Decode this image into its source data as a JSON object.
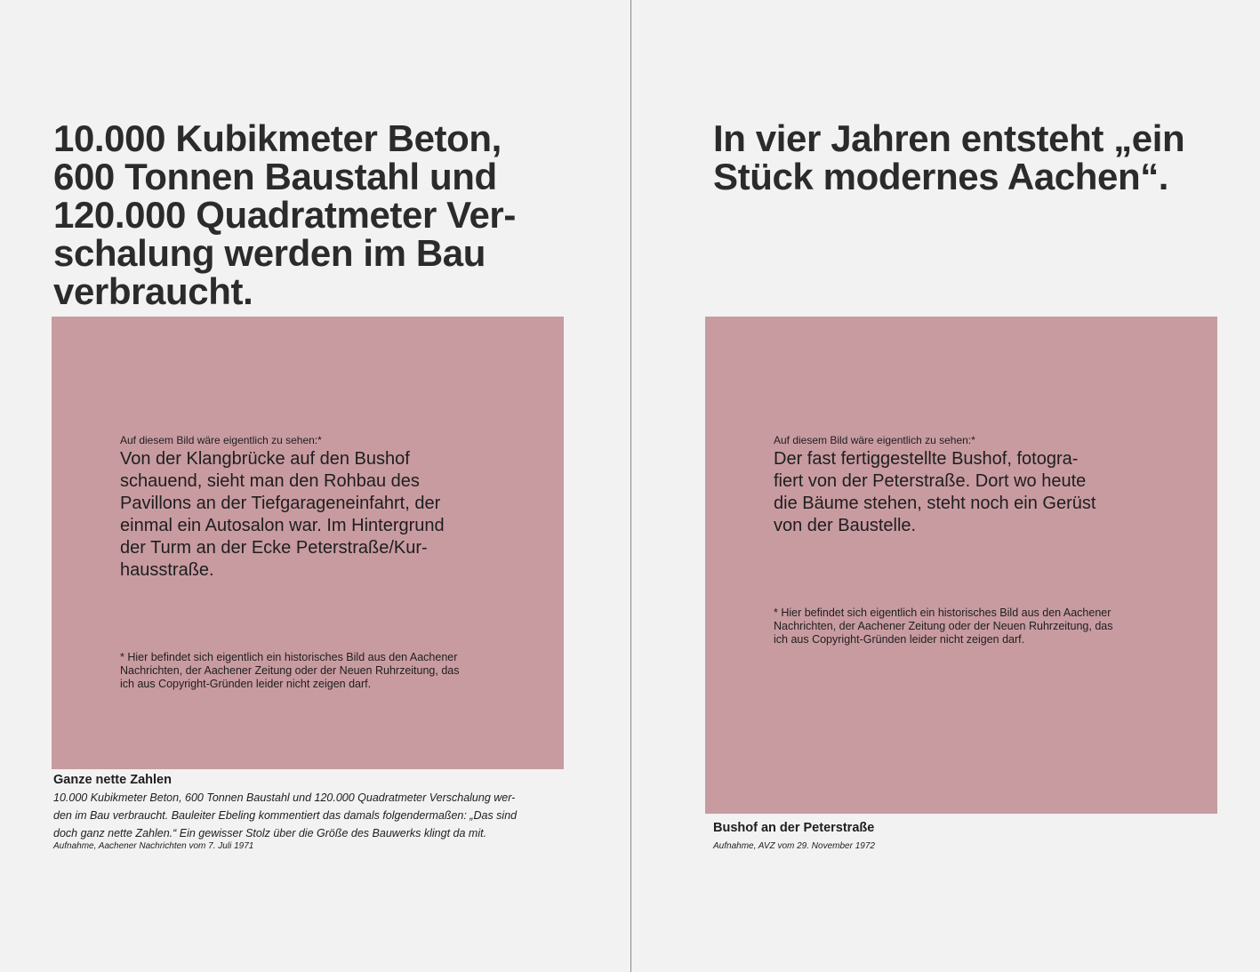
{
  "left_page": {
    "headline": "10.000 Kubikmeter Beton,\n600 Tonnen Baustahl und\n120.000 Quadratmeter Ver-\nschalung werden im Bau\nverbraucht.",
    "placeholder": {
      "intro": "Auf diesem Bild wäre eigentlich zu sehen:*",
      "description": "Von der Klangbrücke auf den Bushof\nschauend, sieht man den Rohbau des\nPavillons an der Tiefgarageneinfahrt, der\neinmal ein Autosalon war. Im Hintergrund\nder Turm an der Ecke Peterstraße/Kur-\nhausstraße.",
      "footnote": "* Hier befindet sich eigentlich ein historisches Bild aus den Aachener\nNachrichten, der Aachener Zeitung oder der Neuen Ruhrzeitung, das\nich aus Copyright-Gründen leider nicht zeigen darf."
    },
    "caption": {
      "title": "Ganze nette Zahlen",
      "text": "10.000 Kubikmeter Beton, 600 Tonnen Baustahl und 120.000 Quadratmeter Verschalung wer-\nden im Bau verbraucht. Bauleiter Ebeling kommentiert das damals folgendermaßen: „Das sind\ndoch ganz nette Zahlen.“ Ein gewisser Stolz über die Größe des Bauwerks klingt da mit.",
      "source": "Aufnahme, Aachener Nachrichten vom 7. Juli 1971"
    }
  },
  "right_page": {
    "headline": "In vier Jahren entsteht „ein\nStück modernes Aachen“.",
    "placeholder": {
      "intro": "Auf diesem Bild wäre eigentlich zu sehen:*",
      "description": "Der fast fertiggestellte Bushof, fotogra-\nfiert von der Peterstraße. Dort wo heute\ndie Bäume stehen, steht noch ein Gerüst\nvon der Baustelle.",
      "footnote": "* Hier befindet sich eigentlich ein historisches Bild aus den Aachener\nNachrichten, der Aachener Zeitung oder der Neuen Ruhrzeitung, das\nich aus Copyright-Gründen leider nicht zeigen darf."
    },
    "caption": {
      "title": "Bushof an der Peterstraße",
      "source": "Aufnahme, AVZ vom 29. November 1972"
    }
  },
  "colors": {
    "background": "#f2f2f2",
    "placeholder": "#c89ba1",
    "text": "#2b2b2b",
    "gutter": "#8a8a8a"
  }
}
